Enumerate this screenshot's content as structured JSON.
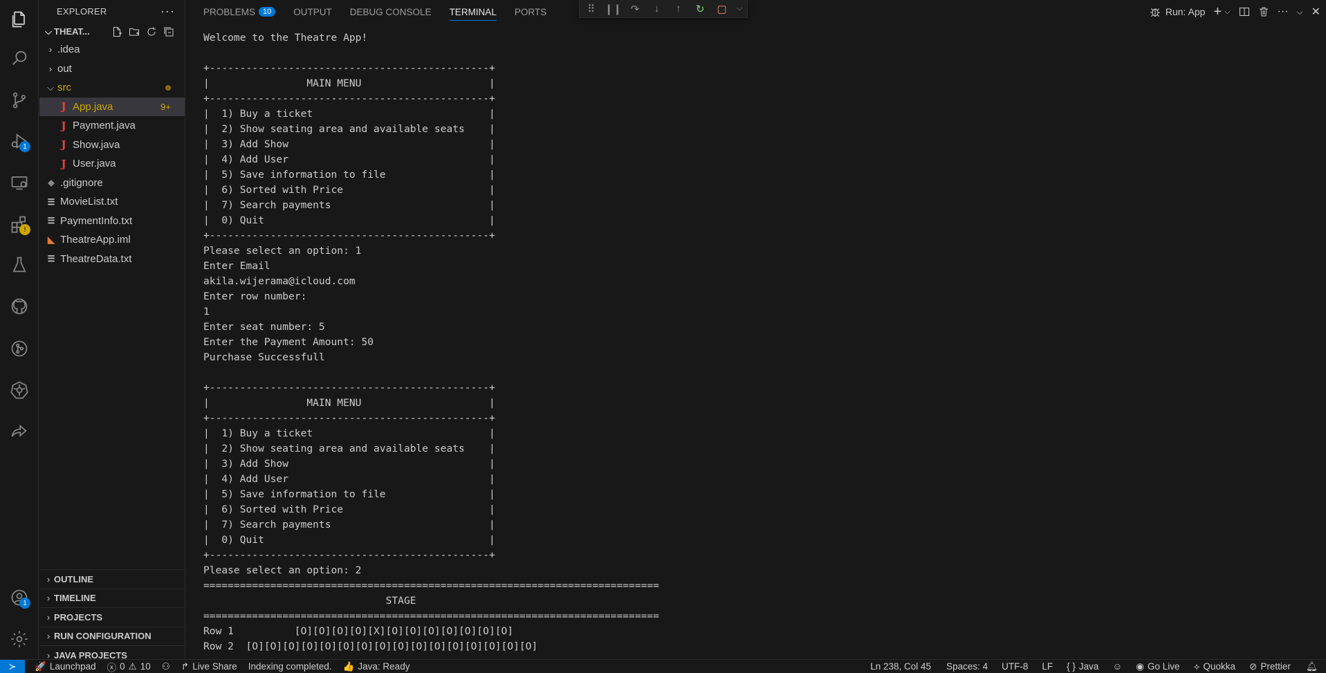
{
  "activity_bar": {
    "run_debug_badge": "1",
    "extensions_badge": "!",
    "accounts_badge": "1"
  },
  "explorer": {
    "title": "EXPLORER",
    "root_folder": "THEAT...",
    "tree": [
      {
        "type": "folder",
        "name": ".idea",
        "expanded": false,
        "depth": 1
      },
      {
        "type": "folder",
        "name": "out",
        "expanded": false,
        "depth": 1
      },
      {
        "type": "folder",
        "name": "src",
        "expanded": true,
        "depth": 1,
        "modified": true
      },
      {
        "type": "java",
        "name": "App.java",
        "depth": 2,
        "active": true,
        "problems": "9+"
      },
      {
        "type": "java",
        "name": "Payment.java",
        "depth": 2
      },
      {
        "type": "java",
        "name": "Show.java",
        "depth": 2
      },
      {
        "type": "java",
        "name": "User.java",
        "depth": 2
      },
      {
        "type": "git",
        "name": ".gitignore",
        "depth": 1
      },
      {
        "type": "txt",
        "name": "MovieList.txt",
        "depth": 1
      },
      {
        "type": "txt",
        "name": "PaymentInfo.txt",
        "depth": 1
      },
      {
        "type": "rss",
        "name": "TheatreApp.iml",
        "depth": 1
      },
      {
        "type": "txt",
        "name": "TheatreData.txt",
        "depth": 1
      }
    ],
    "sections": [
      "OUTLINE",
      "TIMELINE",
      "PROJECTS",
      "RUN CONFIGURATION",
      "JAVA PROJECTS"
    ]
  },
  "panel": {
    "tabs": [
      {
        "label": "PROBLEMS",
        "count": "10"
      },
      {
        "label": "OUTPUT"
      },
      {
        "label": "DEBUG CONSOLE"
      },
      {
        "label": "TERMINAL",
        "active": true
      },
      {
        "label": "PORTS"
      }
    ],
    "run_label": "Run: App"
  },
  "terminal_lines": [
    "Welcome to the Theatre App!",
    "",
    "+----------------------------------------------+",
    "|                MAIN MENU                     |",
    "+----------------------------------------------+",
    "|  1) Buy a ticket                             |",
    "|  2) Show seating area and available seats    |",
    "|  3) Add Show                                 |",
    "|  4) Add User                                 |",
    "|  5) Save information to file                 |",
    "|  6) Sorted with Price                        |",
    "|  7) Search payments                          |",
    "|  0) Quit                                     |",
    "+----------------------------------------------+",
    "Please select an option: 1",
    "Enter Email",
    "akila.wijerama@icloud.com",
    "Enter row number:",
    "1",
    "Enter seat number: 5",
    "Enter the Payment Amount: 50",
    "Purchase Successfull",
    "",
    "+----------------------------------------------+",
    "|                MAIN MENU                     |",
    "+----------------------------------------------+",
    "|  1) Buy a ticket                             |",
    "|  2) Show seating area and available seats    |",
    "|  3) Add Show                                 |",
    "|  4) Add User                                 |",
    "|  5) Save information to file                 |",
    "|  6) Sorted with Price                        |",
    "|  7) Search payments                          |",
    "|  0) Quit                                     |",
    "+----------------------------------------------+",
    "Please select an option: 2",
    "===========================================================================",
    "                              STAGE",
    "===========================================================================",
    "Row 1          [O][O][O][O][X][O][O][O][O][O][O][O]",
    "Row 2  [O][O][O][O][O][O][O][O][O][O][O][O][O][O][O][O]"
  ],
  "statusbar": {
    "launchpad": "Launchpad",
    "errors": "0",
    "warnings": "10",
    "live_share": "Live Share",
    "indexing": "Indexing completed.",
    "java_status": "Java: Ready",
    "position": "Ln 238, Col 45",
    "spaces": "Spaces: 4",
    "encoding": "UTF-8",
    "eol": "LF",
    "language": "Java",
    "go_live": "Go Live",
    "quokka": "Quokka",
    "prettier": "Prettier"
  },
  "colors": {
    "accent": "#0078d4",
    "java_icon": "#e0413d",
    "modified": "#cca700",
    "background": "#181818"
  }
}
